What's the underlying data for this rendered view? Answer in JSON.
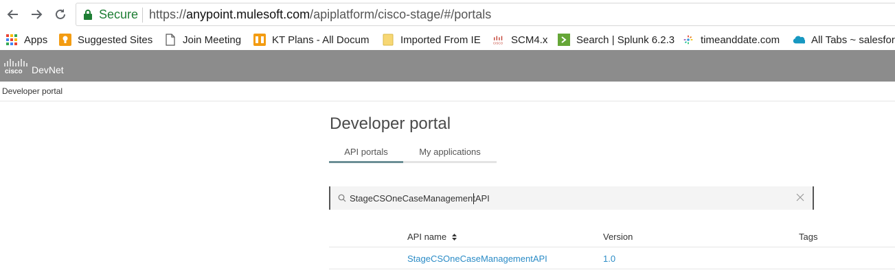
{
  "browser": {
    "secure_label": "Secure",
    "url_scheme": "https://",
    "url_host": "anypoint.mulesoft.com",
    "url_path": "/apiplatform/cisco-stage/#/portals"
  },
  "bookmarks": [
    {
      "label": "Apps",
      "icon": "apps-grid-icon"
    },
    {
      "label": "Suggested Sites",
      "icon": "suggested-sites-icon"
    },
    {
      "label": "Join Meeting",
      "icon": "page-icon"
    },
    {
      "label": "KT Plans - All Docume",
      "icon": "office-docs-icon"
    },
    {
      "label": "Imported From IE",
      "icon": "folder-icon"
    },
    {
      "label": "SCM4.x",
      "icon": "cisco-icon"
    },
    {
      "label": "Search | Splunk 6.2.3",
      "icon": "splunk-icon"
    },
    {
      "label": "timeanddate.com",
      "icon": "timeanddate-icon"
    },
    {
      "label": "All Tabs ~ salesfor",
      "icon": "salesforce-cloud-icon"
    }
  ],
  "header": {
    "logo_text": "cisco",
    "brand": "DevNet"
  },
  "breadcrumb": "Developer portal",
  "page": {
    "title": "Developer portal",
    "tabs": [
      {
        "label": "API portals",
        "active": true
      },
      {
        "label": "My applications",
        "active": false
      }
    ]
  },
  "search": {
    "value": "StageCSOneCaseManagementAPI"
  },
  "table": {
    "headers": {
      "name": "API name",
      "version": "Version",
      "tags": "Tags"
    },
    "rows": [
      {
        "name": "StageCSOneCaseManagementAPI",
        "version": "1.0",
        "tags": ""
      }
    ]
  },
  "colors": {
    "header_bg": "#8c8c8c",
    "secure_green": "#1e7e34",
    "link_blue": "#2a8bc6",
    "active_tab_underline": "#6b8e95"
  }
}
